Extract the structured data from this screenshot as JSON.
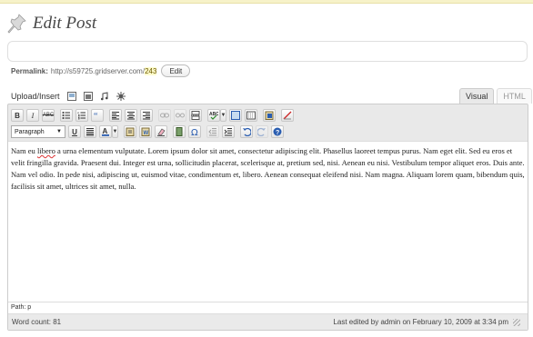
{
  "page": {
    "title": "Edit Post"
  },
  "title_field": {
    "value": ""
  },
  "permalink": {
    "label": "Permalink:",
    "url_prefix": "http://s59725.gridserver.com/",
    "slug": "243",
    "edit_label": "Edit"
  },
  "media": {
    "label": "Upload/Insert",
    "icons": [
      "image-icon",
      "video-icon",
      "audio-icon",
      "media-icon"
    ]
  },
  "tabs": [
    {
      "label": "Visual",
      "active": true
    },
    {
      "label": "HTML",
      "active": false
    }
  ],
  "toolbar": {
    "format_select": "Paragraph"
  },
  "content": {
    "word_before": "Nam eu ",
    "misspelled": "libero",
    "word_after": " a urna elementum vulputate. Lorem ipsum dolor sit amet, consectetur adipiscing elit. Phasellus laoreet tempus purus. Nam eget elit. Sed eu eros et velit fringilla gravida. Praesent dui. Integer est urna, sollicitudin placerat, scelerisque at, pretium sed, nisi. Aenean eu nisi. Vestibulum tempor aliquet eros. Duis ante. Nam vel odio. In pede nisi, adipiscing ut, euismod vitae, condimentum et, libero. Aenean consequat eleifend nisi. Nam magna. Aliquam lorem quam, bibendum quis, facilisis sit amet, ultrices sit amet, nulla."
  },
  "path": {
    "label": "Path: p"
  },
  "status": {
    "word_count": "Word count: 81",
    "last_edited": "Last edited by admin on February 10, 2009 at 3:34 pm"
  },
  "colors": {
    "accent": "#21759b",
    "toolbar_bg": "#e9e9e9",
    "slug_highlight": "#fffbcc"
  }
}
